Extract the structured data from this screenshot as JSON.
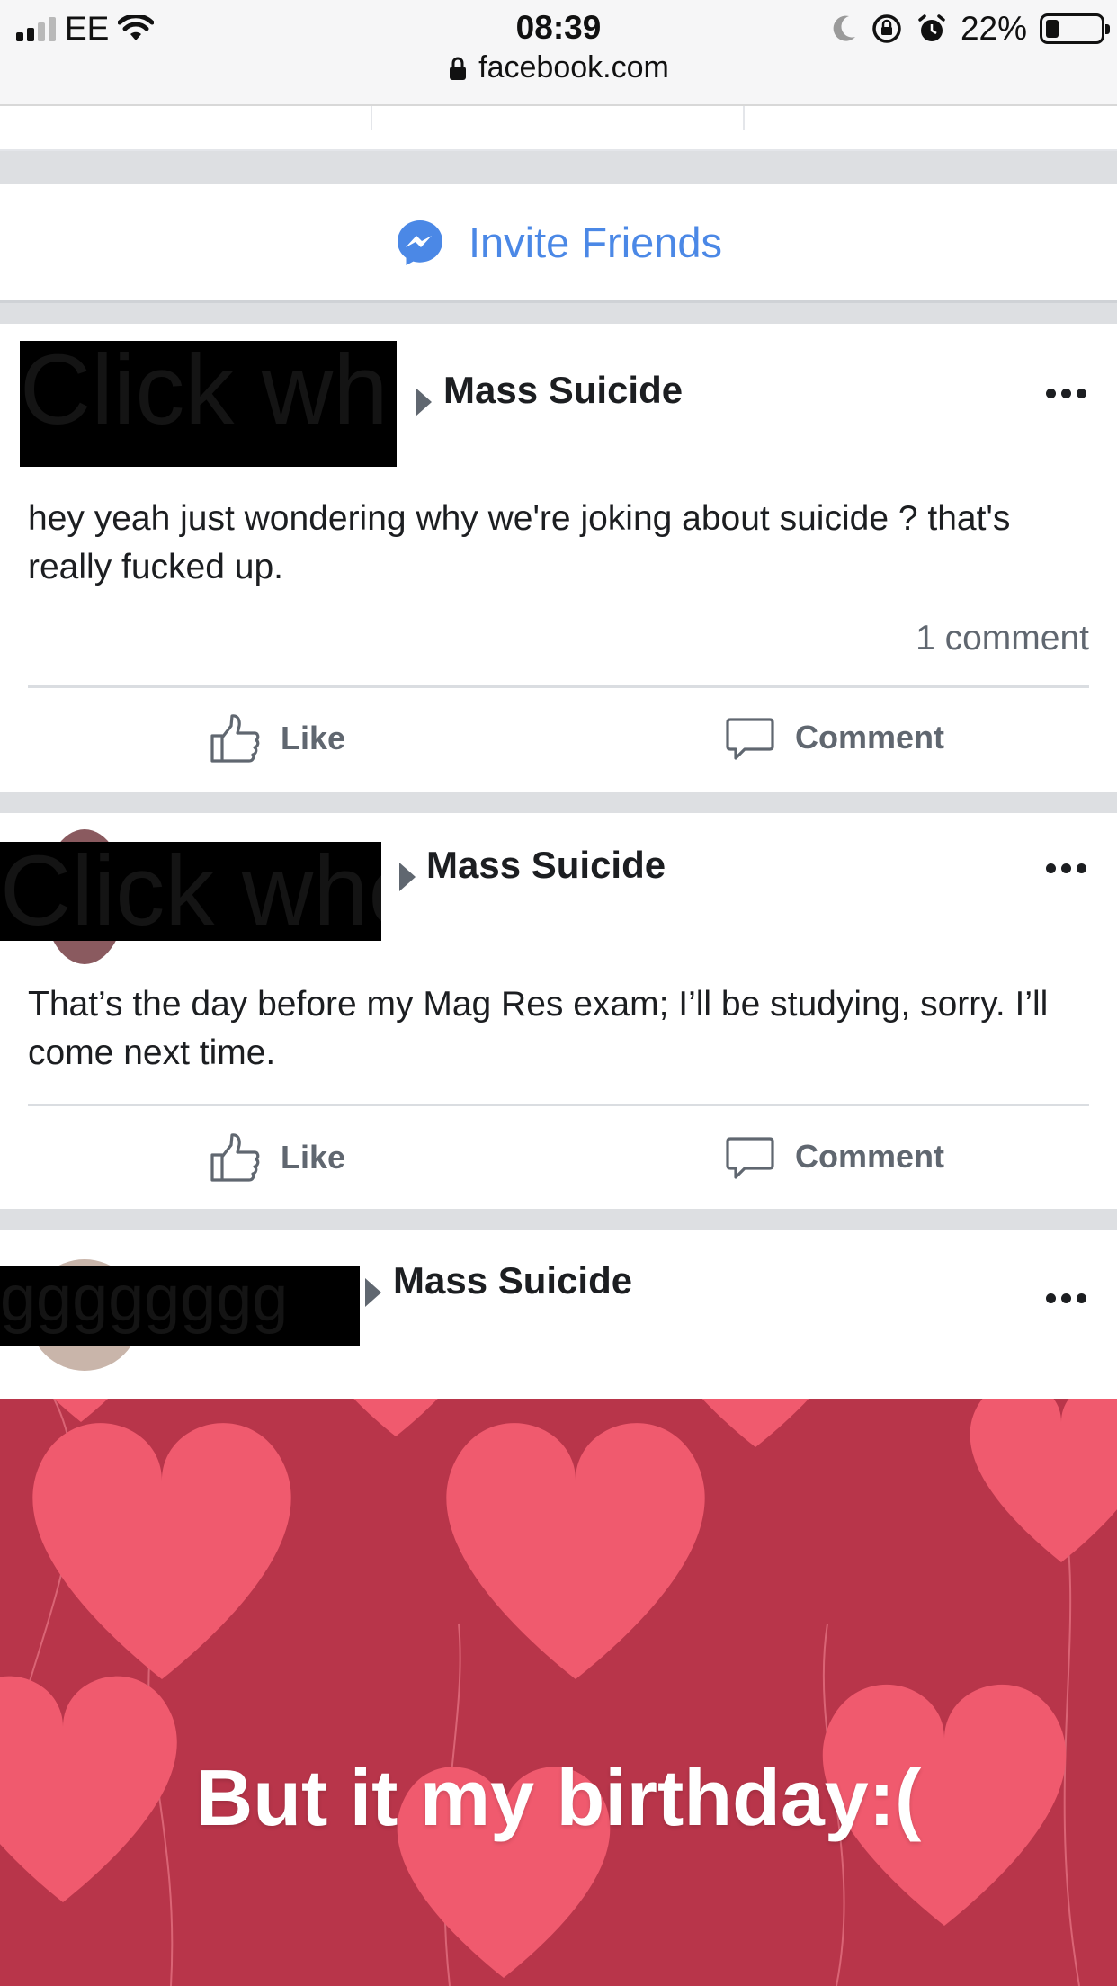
{
  "status_bar": {
    "carrier": "EE",
    "time": "08:39",
    "battery_percent": "22%",
    "battery_level": 0.22
  },
  "url_bar": {
    "domain": "facebook.com"
  },
  "invite": {
    "label": "Invite Friends"
  },
  "posts": [
    {
      "redacted_name": "Click wh",
      "group": "Mass Suicide",
      "text": "hey yeah just wondering why we're joking about suicide ? that's really fucked up.",
      "comments": "1 comment",
      "like_label": "Like",
      "comment_label": "Comment"
    },
    {
      "redacted_name": "Click whe",
      "group": "Mass Suicide",
      "text": "That’s the day before my Mag Res exam; I’ll be studying, sorry. I’ll come next time.",
      "like_label": "Like",
      "comment_label": "Comment"
    },
    {
      "redacted_name": "gggggggg",
      "group": "Mass Suicide"
    }
  ],
  "birthday_post": {
    "text": "But it my birthday:("
  },
  "colors": {
    "facebook_blue": "#4b88e6",
    "background_red": "#b8354a",
    "heart_pink": "#f05a6e"
  }
}
